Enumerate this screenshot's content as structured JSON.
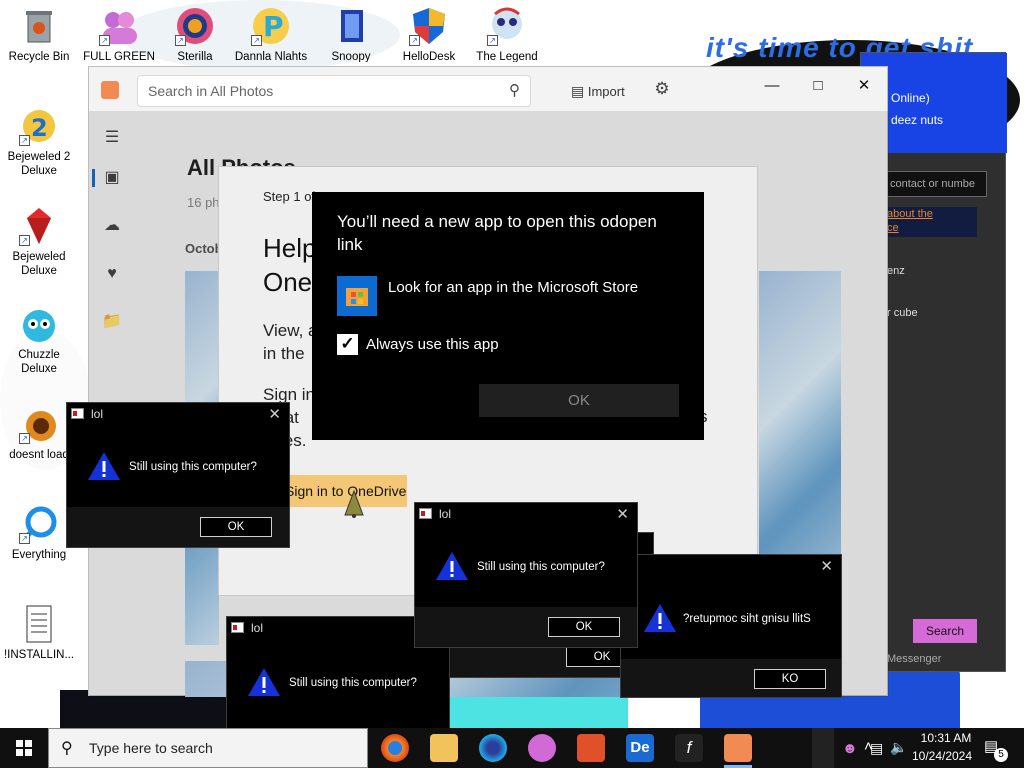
{
  "desktop": {
    "icons": [
      {
        "label": "Recycle Bin"
      },
      {
        "label": "FULL GREEN"
      },
      {
        "label": "Sterilla"
      },
      {
        "label": "Dannla Nlahts"
      },
      {
        "label": "Snoopy"
      },
      {
        "label": "HelloDesk"
      },
      {
        "label": "The Legend"
      },
      {
        "label": "Bejeweled 2 Deluxe"
      },
      {
        "label": "Bejeweled Deluxe"
      },
      {
        "label": "Chuzzle Deluxe"
      },
      {
        "label": "doesnt load"
      },
      {
        "label": "Everything"
      },
      {
        "label": "!INSTALLIN..."
      }
    ],
    "banner_text": "it's time to get shit"
  },
  "messenger": {
    "status": "Online)",
    "nickname": "deez nuts",
    "search_placeholder": "contact or numbe",
    "link_line1": "about the",
    "link_line2": "ce",
    "contact1": "enz",
    "contact2": "r cube",
    "search_button": "Search",
    "footer": "Messenger"
  },
  "photos": {
    "search_placeholder": "Search in All Photos",
    "import_label": "Import",
    "page_title": "All Photos",
    "count": "16 ph",
    "month": "Octob"
  },
  "onedrive": {
    "step": "Step 1 of 3",
    "heading_line1": "Help",
    "heading_line2": "One",
    "body1_line1": "View, a",
    "body1_line2": "in the",
    "body2_line1": "Sign in",
    "body2_line2": "ociat",
    "body2_line3": "vices.",
    "body2_tail": "s",
    "signin_label": "Sign in to OneDrive"
  },
  "open_with_dialog": {
    "title": "You’ll need a new app to open this odopen link",
    "store_option": "Look for an app in the Microsoft Store",
    "checkbox_label": "Always use this app",
    "checked": true,
    "ok_label": "OK"
  },
  "lol_dialogs": [
    {
      "title": "lol",
      "message": "Still using this computer?",
      "ok": "OK"
    },
    {
      "title": "lol",
      "message": "Still using this computer?",
      "ok": "OK"
    },
    {
      "title": "lol",
      "message": "Still using this computer?",
      "ok": "OK"
    },
    {
      "title": "lol",
      "message": "Still using this computer?",
      "ok": "OK"
    },
    {
      "title": "",
      "message": "?retupmoc siht gnisu llitS",
      "ok": "KO"
    }
  ],
  "taskbar": {
    "search_placeholder": "Type here to search",
    "time": "10:31 AM",
    "date": "10/24/2024",
    "notification_count": "5"
  },
  "colors": {
    "accent": "#0d6ad1",
    "banner": "#2c6de3",
    "warning_triangle": "#1432d8",
    "onedrive_button": "#f4c776"
  }
}
